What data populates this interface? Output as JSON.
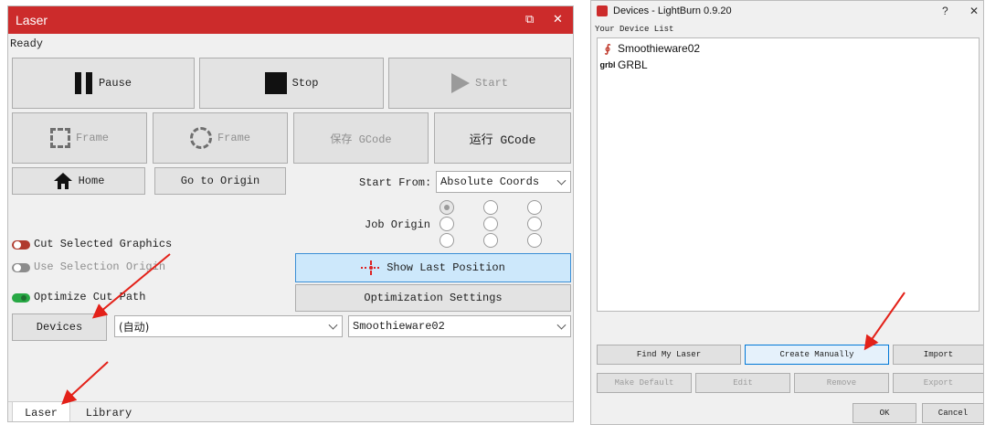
{
  "laser_panel": {
    "title": "Laser",
    "titlebar_icons": {
      "float": "⧉",
      "close": "✕"
    },
    "status": "Ready",
    "buttons": {
      "pause": "Pause",
      "stop": "Stop",
      "start": "Start",
      "frame_rect": "Frame",
      "frame_circle": "Frame",
      "save_gcode": "保存 GCode",
      "run_gcode": "运行 GCode",
      "home": "Home",
      "go_to_origin": "Go to Origin",
      "show_last_position": "Show Last Position",
      "optimization_settings": "Optimization Settings",
      "devices": "Devices"
    },
    "start_from": {
      "label": "Start From:",
      "value": "Absolute Coords"
    },
    "job_origin": {
      "label": "Job Origin",
      "selected_index": 0
    },
    "toggles": [
      {
        "label": "Cut Selected Graphics",
        "color": "#b03a2e",
        "on": false,
        "enabled": true
      },
      {
        "label": "Use Selection Origin",
        "color": "#8c8c8c",
        "on": false,
        "enabled": false
      },
      {
        "label": "Optimize Cut Path",
        "color": "#27a844",
        "on": true,
        "enabled": true
      }
    ],
    "port_select": {
      "value": "(自动)"
    },
    "device_select": {
      "value": "Smoothieware02"
    },
    "tabs": [
      {
        "label": "Laser",
        "active": true
      },
      {
        "label": "Library",
        "active": false
      }
    ]
  },
  "devices_dialog": {
    "title": "Devices - LightBurn 0.9.20",
    "titlebar_icons": {
      "help": "?",
      "close": "✕"
    },
    "list_label": "Your Device List",
    "devices": [
      {
        "name": "Smoothieware02",
        "icon": "smoothie-icon",
        "icon_glyph": "∮",
        "icon_color": "#c0392b"
      },
      {
        "name": "GRBL",
        "icon": "grbl-icon",
        "icon_glyph": "grbl",
        "icon_color": "#111111"
      }
    ],
    "buttons_row1": [
      "Find My Laser",
      "Create Manually",
      "Import"
    ],
    "buttons_row2": [
      "Make Default",
      "Edit",
      "Remove",
      "Export"
    ],
    "ok": "OK",
    "cancel": "Cancel"
  },
  "colors": {
    "titlebar": "#cc2b2b",
    "annotation_arrow": "#e32119",
    "highlight_blue": "#cde8fb"
  }
}
